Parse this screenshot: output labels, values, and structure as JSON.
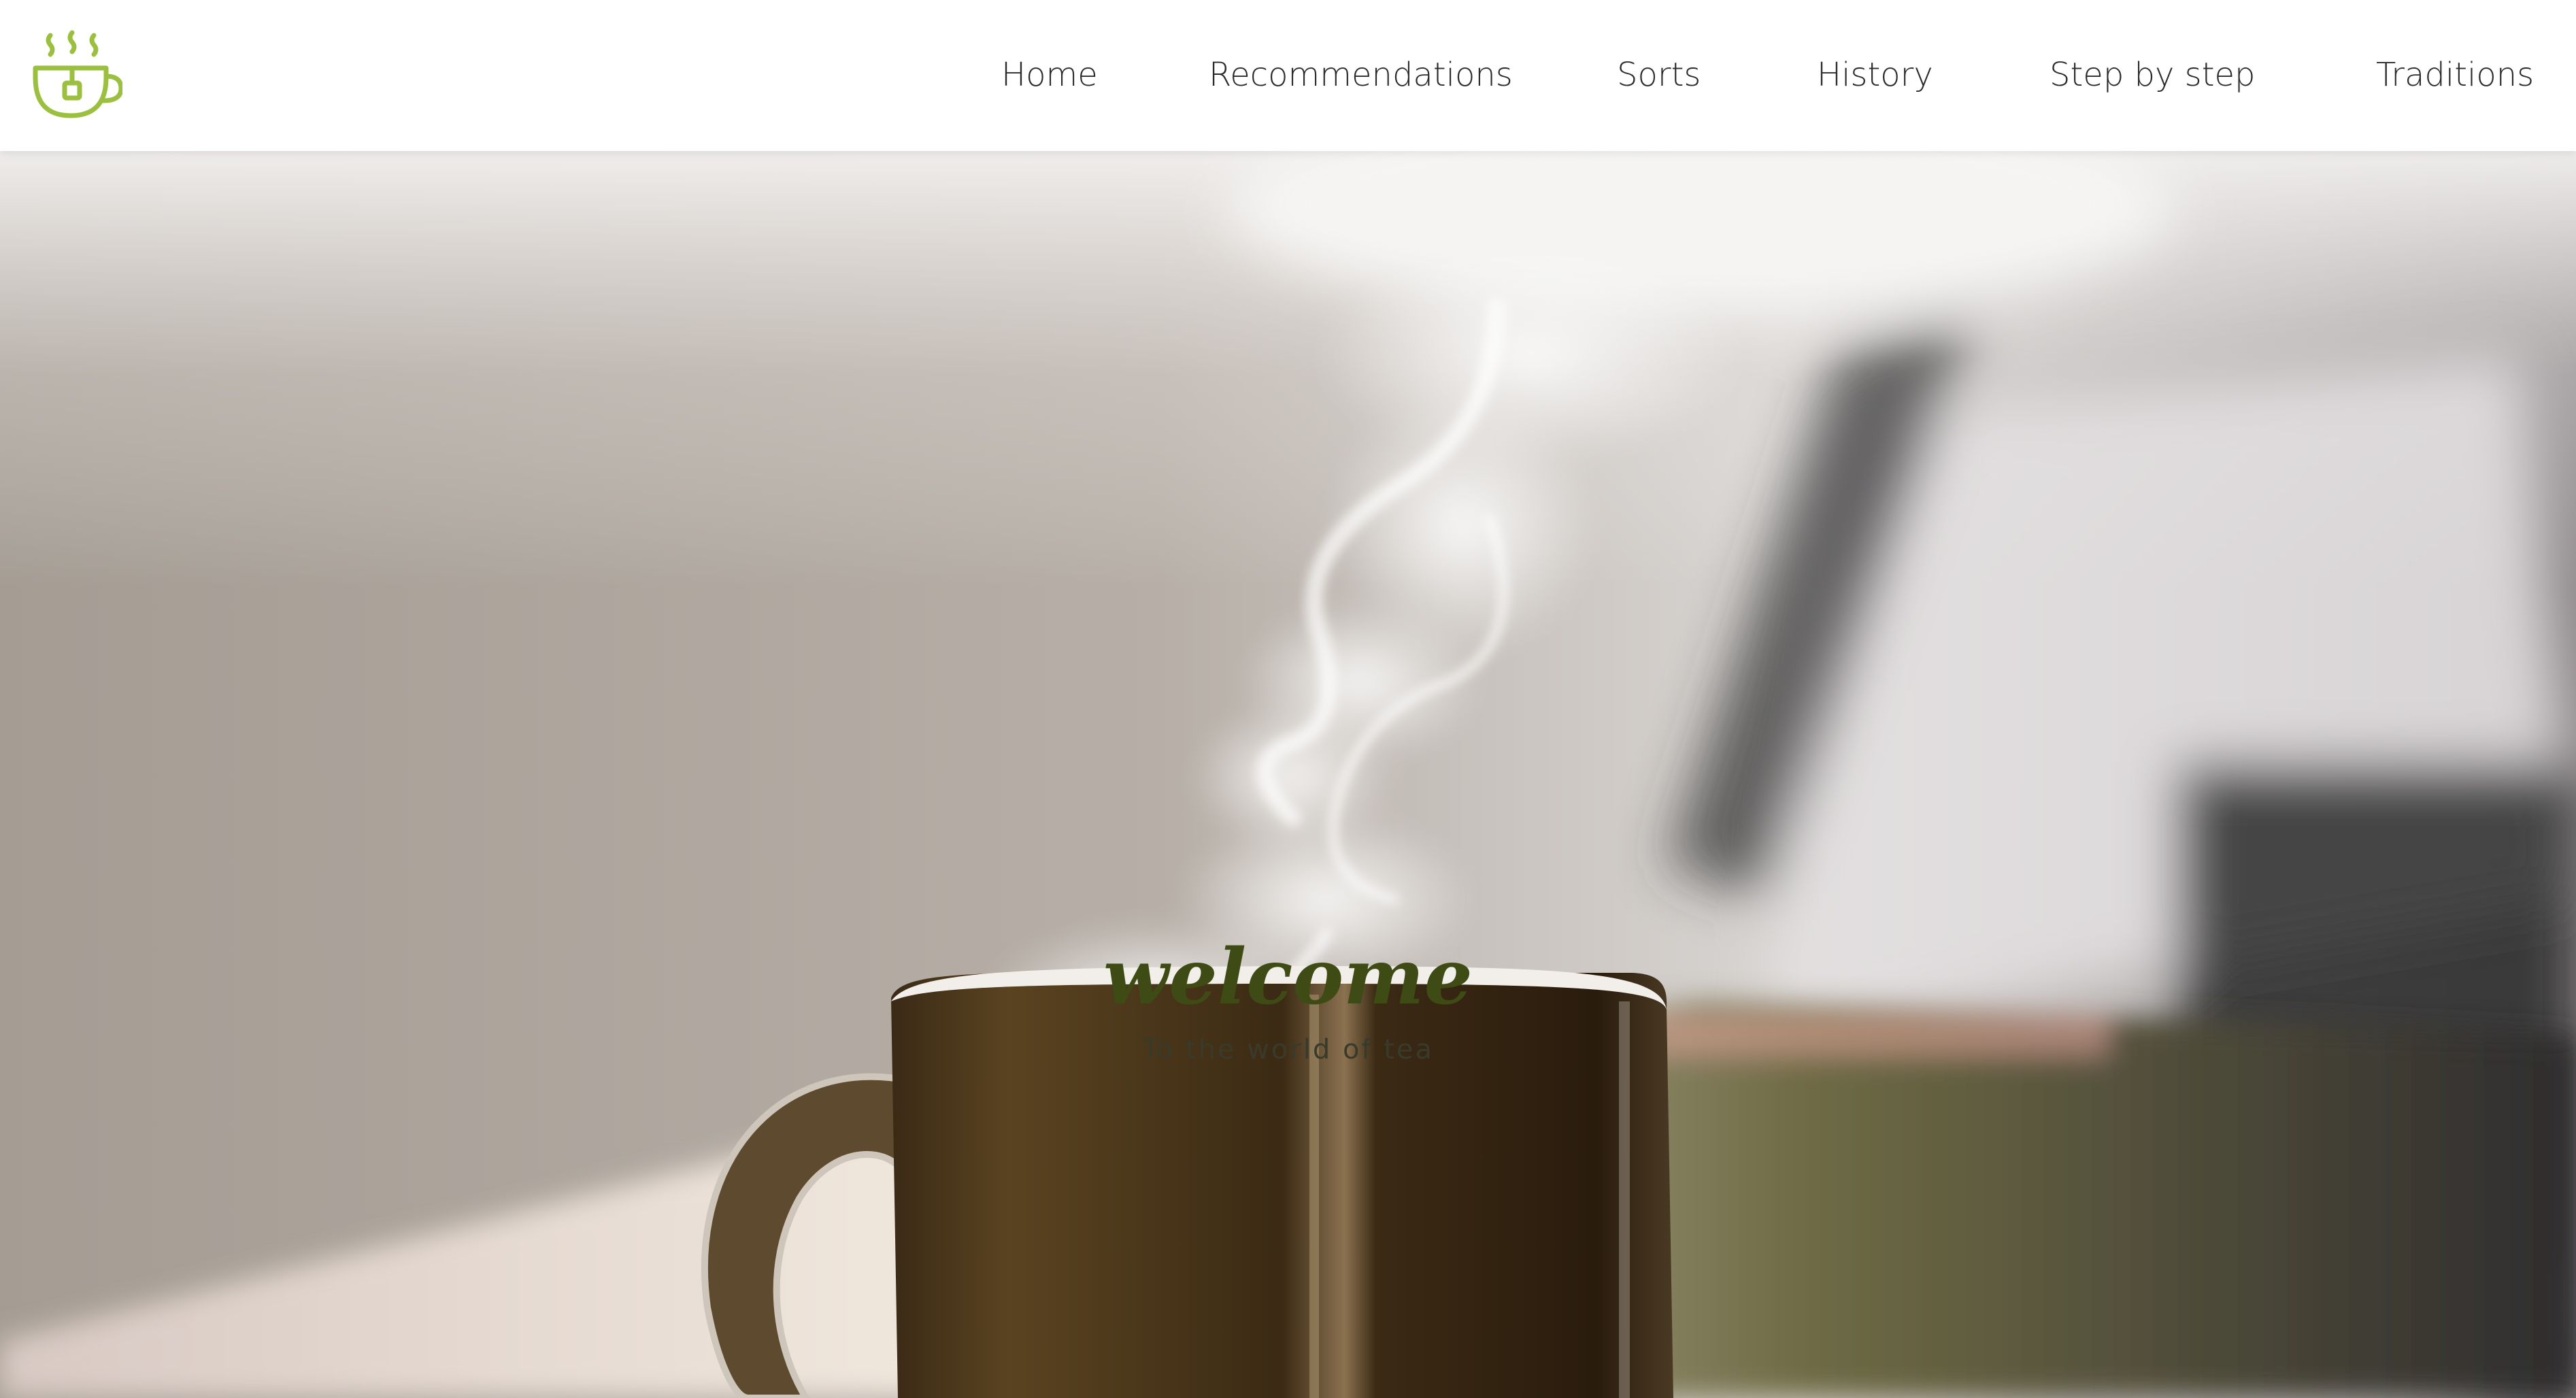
{
  "brand": {
    "logo_icon": "tea-cup-icon",
    "accent_color": "#9bbf3e"
  },
  "nav": {
    "items": [
      {
        "label": "Home"
      },
      {
        "label": "Recommendations"
      },
      {
        "label": "Sorts"
      },
      {
        "label": "History"
      },
      {
        "label": "Step by step"
      },
      {
        "label": "Traditions"
      }
    ]
  },
  "hero": {
    "image": "steaming-tea-cup-photo",
    "title": "welcome",
    "subtitle": "To the world of tea",
    "title_color": "#3f4b14"
  }
}
